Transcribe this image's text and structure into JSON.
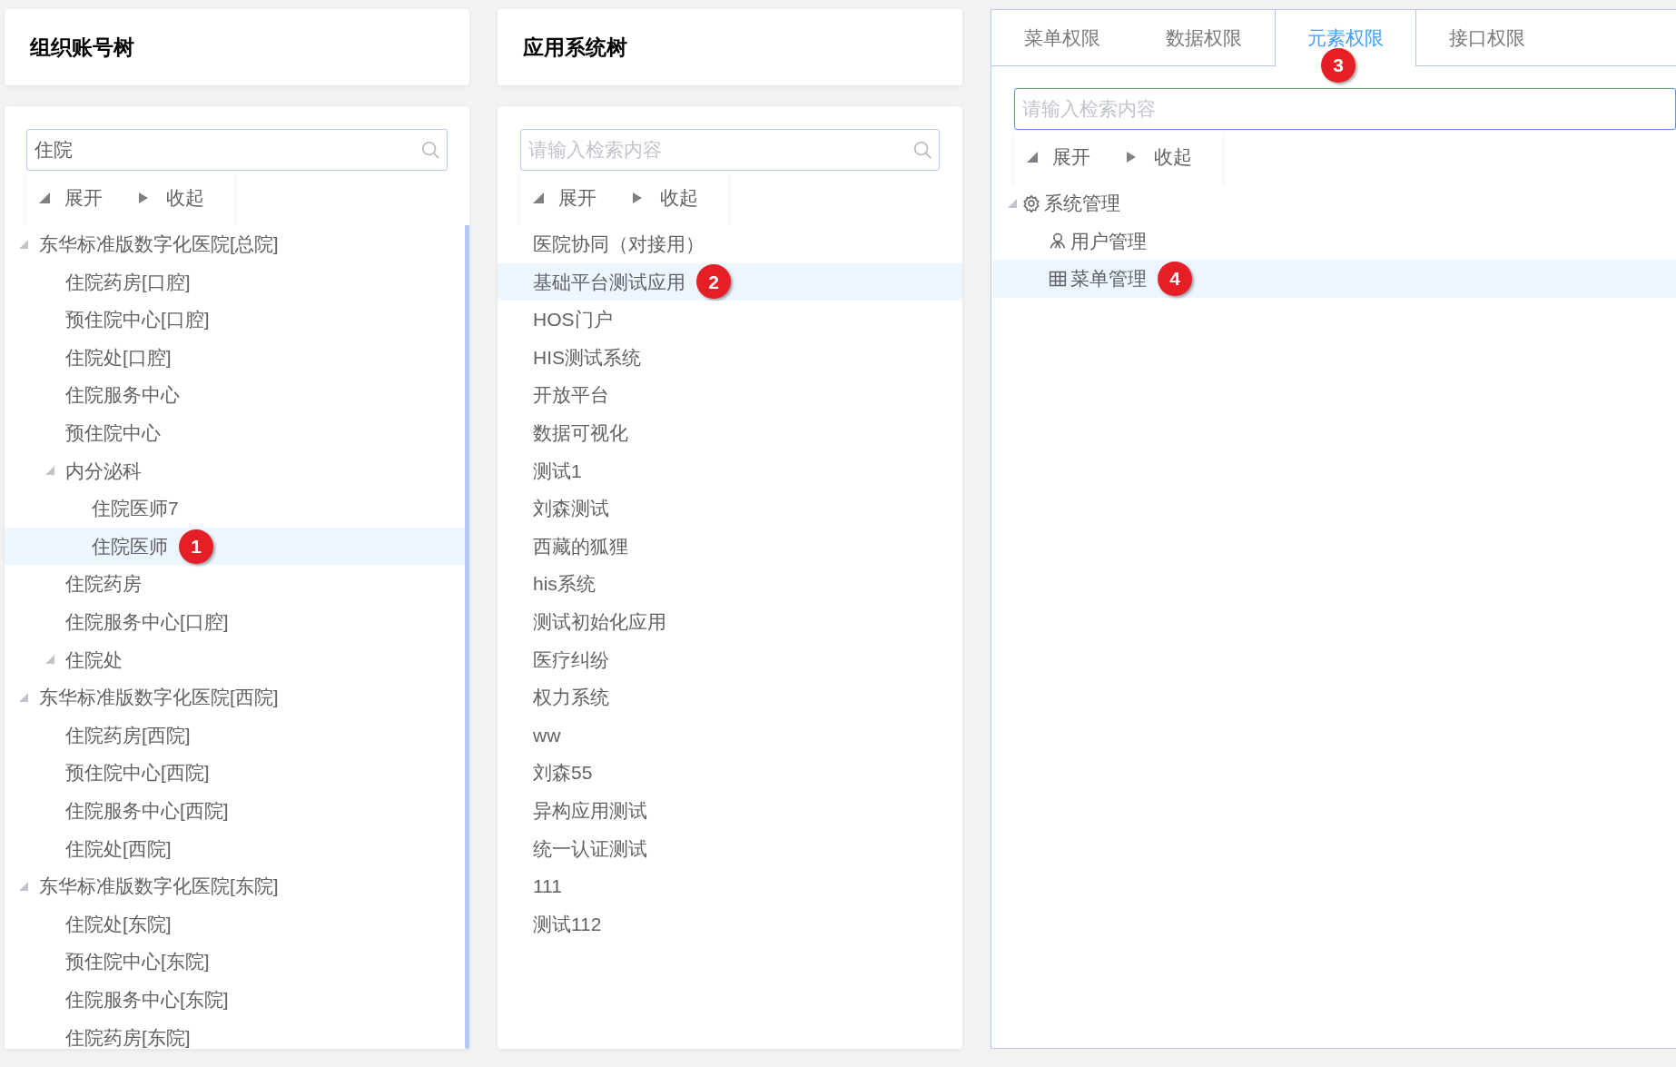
{
  "org_panel": {
    "title": "组织账号树",
    "search": {
      "value": "住院"
    },
    "toolbar": {
      "expand": "展开",
      "collapse": "收起"
    },
    "tree": [
      {
        "label": "东华标准版数字化医院[总院]",
        "expanded": true,
        "selected": false,
        "children": [
          {
            "label": "住院药房[口腔]",
            "selected": false
          },
          {
            "label": "预住院中心[口腔]",
            "selected": false
          },
          {
            "label": "住院处[口腔]",
            "selected": false
          },
          {
            "label": "住院服务中心",
            "selected": false
          },
          {
            "label": "预住院中心",
            "selected": false
          },
          {
            "label": "内分泌科",
            "expanded": true,
            "selected": false,
            "children": [
              {
                "label": "住院医师7",
                "selected": false
              },
              {
                "label": "住院医师",
                "selected": true,
                "badge": "1"
              }
            ]
          },
          {
            "label": "住院药房",
            "selected": false
          },
          {
            "label": "住院服务中心[口腔]",
            "selected": false
          },
          {
            "label": "住院处",
            "expanded": true,
            "selected": false
          }
        ]
      },
      {
        "label": "东华标准版数字化医院[西院]",
        "expanded": true,
        "selected": false,
        "children": [
          {
            "label": "住院药房[西院]",
            "selected": false
          },
          {
            "label": "预住院中心[西院]",
            "selected": false
          },
          {
            "label": "住院服务中心[西院]",
            "selected": false
          },
          {
            "label": "住院处[西院]",
            "selected": false
          }
        ]
      },
      {
        "label": "东华标准版数字化医院[东院]",
        "expanded": true,
        "selected": false,
        "children": [
          {
            "label": "住院处[东院]",
            "selected": false
          },
          {
            "label": "预住院中心[东院]",
            "selected": false
          },
          {
            "label": "住院服务中心[东院]",
            "selected": false
          },
          {
            "label": "住院药房[东院]",
            "selected": false
          }
        ]
      }
    ]
  },
  "app_panel": {
    "title": "应用系统树",
    "search": {
      "placeholder": "请输入检索内容"
    },
    "toolbar": {
      "expand": "展开",
      "collapse": "收起"
    },
    "items": [
      {
        "label": "医院协同（对接用）",
        "selected": false
      },
      {
        "label": "基础平台测试应用",
        "selected": true,
        "badge": "2"
      },
      {
        "label": "HOS门户",
        "selected": false
      },
      {
        "label": "HIS测试系统",
        "selected": false
      },
      {
        "label": "开放平台",
        "selected": false
      },
      {
        "label": "数据可视化",
        "selected": false
      },
      {
        "label": "测试1",
        "selected": false
      },
      {
        "label": "刘森测试",
        "selected": false
      },
      {
        "label": "西藏的狐狸",
        "selected": false
      },
      {
        "label": "his系统",
        "selected": false
      },
      {
        "label": "测试初始化应用",
        "selected": false
      },
      {
        "label": "医疗纠纷",
        "selected": false
      },
      {
        "label": "权力系统",
        "selected": false
      },
      {
        "label": "ww",
        "selected": false
      },
      {
        "label": "刘森55",
        "selected": false
      },
      {
        "label": "异构应用测试",
        "selected": false
      },
      {
        "label": "统一认证测试",
        "selected": false
      },
      {
        "label": "111",
        "selected": false
      },
      {
        "label": "测试112",
        "selected": false
      }
    ]
  },
  "permission_panel": {
    "tabs": [
      {
        "label": "菜单权限",
        "selected": false
      },
      {
        "label": "数据权限",
        "selected": false
      },
      {
        "label": "元素权限",
        "selected": true,
        "badge": "3"
      },
      {
        "label": "接口权限",
        "selected": false
      }
    ],
    "search": {
      "placeholder": "请输入检索内容"
    },
    "toolbar": {
      "expand": "展开",
      "collapse": "收起"
    },
    "tree": [
      {
        "label": "系统管理",
        "kind": "group",
        "expanded": true,
        "selected": false,
        "children": [
          {
            "label": "用户管理",
            "kind": "user",
            "selected": false
          },
          {
            "label": "菜单管理",
            "kind": "menu",
            "selected": true,
            "badge": "4"
          }
        ]
      }
    ]
  }
}
